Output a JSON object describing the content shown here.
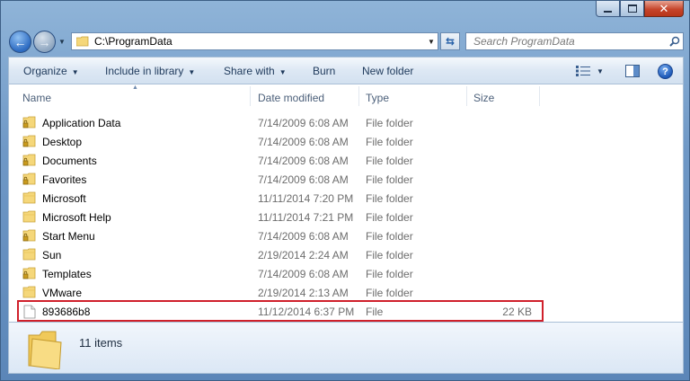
{
  "address": {
    "path": "C:\\ProgramData"
  },
  "search": {
    "placeholder": "Search ProgramData"
  },
  "toolbar": {
    "organize": "Organize",
    "include_in_library": "Include in library",
    "share_with": "Share with",
    "burn": "Burn",
    "new_folder": "New folder"
  },
  "columns": {
    "name": "Name",
    "date": "Date modified",
    "type": "Type",
    "size": "Size"
  },
  "files": [
    {
      "name": "Application Data",
      "date": "7/14/2009 6:08 AM",
      "type": "File folder",
      "size": "",
      "icon": "locked-folder-icon"
    },
    {
      "name": "Desktop",
      "date": "7/14/2009 6:08 AM",
      "type": "File folder",
      "size": "",
      "icon": "locked-folder-icon"
    },
    {
      "name": "Documents",
      "date": "7/14/2009 6:08 AM",
      "type": "File folder",
      "size": "",
      "icon": "locked-folder-icon"
    },
    {
      "name": "Favorites",
      "date": "7/14/2009 6:08 AM",
      "type": "File folder",
      "size": "",
      "icon": "locked-folder-icon"
    },
    {
      "name": "Microsoft",
      "date": "11/11/2014 7:20 PM",
      "type": "File folder",
      "size": "",
      "icon": "folder-icon"
    },
    {
      "name": "Microsoft Help",
      "date": "11/11/2014 7:21 PM",
      "type": "File folder",
      "size": "",
      "icon": "folder-icon"
    },
    {
      "name": "Start Menu",
      "date": "7/14/2009 6:08 AM",
      "type": "File folder",
      "size": "",
      "icon": "locked-folder-icon"
    },
    {
      "name": "Sun",
      "date": "2/19/2014 2:24 AM",
      "type": "File folder",
      "size": "",
      "icon": "folder-icon"
    },
    {
      "name": "Templates",
      "date": "7/14/2009 6:08 AM",
      "type": "File folder",
      "size": "",
      "icon": "locked-folder-icon"
    },
    {
      "name": "VMware",
      "date": "2/19/2014 2:13 AM",
      "type": "File folder",
      "size": "",
      "icon": "folder-icon"
    },
    {
      "name": "893686b8",
      "date": "11/12/2014 6:37 PM",
      "type": "File",
      "size": "22 KB",
      "icon": "file-icon"
    }
  ],
  "details": {
    "count": "11 items"
  },
  "colors": {
    "highlight": "#d0202b",
    "folder": "#f5d77a"
  }
}
